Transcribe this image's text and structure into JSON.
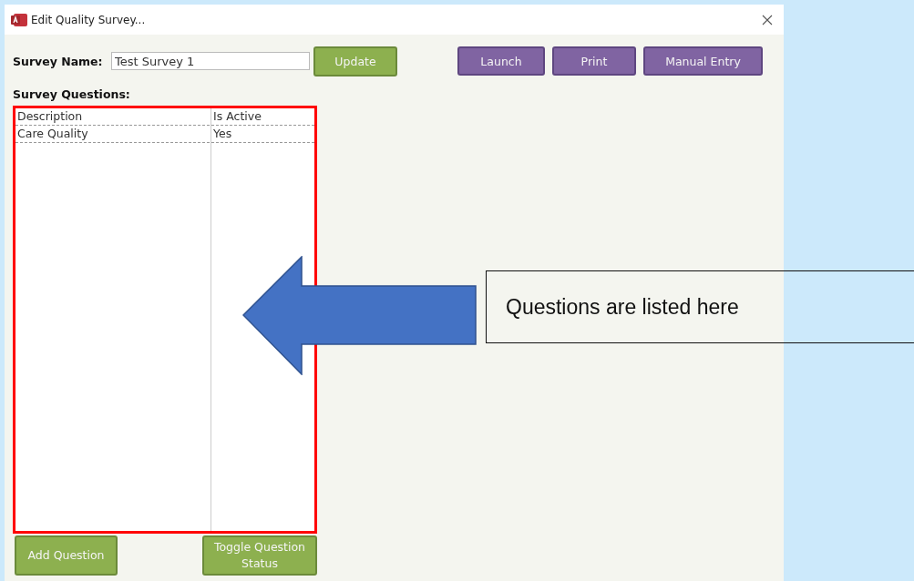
{
  "window": {
    "title": "Edit Quality Survey..."
  },
  "survey_name": {
    "label": "Survey Name:",
    "value": "Test Survey 1"
  },
  "update_button": "Update",
  "action_buttons": [
    "Launch",
    "Print",
    "Manual Entry"
  ],
  "questions_label": "Survey Questions:",
  "table": {
    "columns": [
      "Description",
      "Is Active"
    ],
    "rows": [
      [
        "Care Quality",
        "Yes"
      ]
    ]
  },
  "bottom_buttons": [
    "Add Question",
    "Toggle Question Status"
  ],
  "callout": {
    "text": "Questions are listed here"
  }
}
